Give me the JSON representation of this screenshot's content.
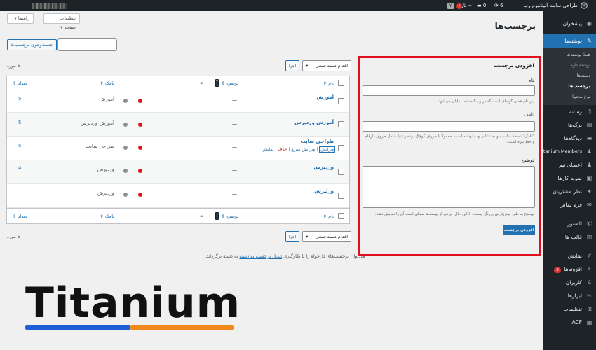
{
  "adminbar": {
    "site_name": "طراحی سایت آتیتانیوم وب",
    "updates": "6",
    "comments": "0",
    "new_label": "تازه",
    "notif_count": "!"
  },
  "top_buttons": {
    "screen_options": "تنظیمات صفحه",
    "help": "راهنما"
  },
  "page_title": "برچسب‌ها",
  "sidebar": {
    "items": [
      {
        "label": "پیشخوان",
        "icon": "dashboard-icon"
      },
      {
        "label": "نوشته‌ها",
        "icon": "pin-icon",
        "current": true
      },
      {
        "label": "رسانه",
        "icon": "media-icon"
      },
      {
        "label": "برگه‌ها",
        "icon": "page-icon"
      },
      {
        "label": "دیدگاه‌ها",
        "icon": "comment-icon"
      },
      {
        "label": "Titanium Members",
        "icon": "members-icon"
      },
      {
        "label": "اعضای تیم",
        "icon": "team-icon"
      },
      {
        "label": "نمونه کارها",
        "icon": "portfolio-icon"
      },
      {
        "label": "نظر مشتریان",
        "icon": "testimonial-icon"
      },
      {
        "label": "فرم تماس",
        "icon": "mail-icon"
      },
      {
        "label": "المنتور",
        "icon": "elementor-icon"
      },
      {
        "label": "قالب ها",
        "icon": "template-icon"
      },
      {
        "label": "نمایش",
        "icon": "brush-icon"
      },
      {
        "label": "افزونه‌ها",
        "icon": "plugin-icon",
        "badge": "5"
      },
      {
        "label": "کاربران",
        "icon": "users-icon"
      },
      {
        "label": "ابزارها",
        "icon": "tools-icon"
      },
      {
        "label": "تنظیمات",
        "icon": "settings-icon"
      },
      {
        "label": "ACF",
        "icon": "acf-icon"
      }
    ],
    "submenu": [
      "همهٔ نوشته‌ها",
      "نوشته تازه",
      "دسته‌ها",
      "برچسب‌ها",
      "نوع محتوا"
    ]
  },
  "search": {
    "button": "جست‌وجوی برچسب‌ها",
    "placeholder": ""
  },
  "add_tag": {
    "heading": "افزودن برچسب",
    "name_label": "نام",
    "name_desc": "این نام همان گونه‌ای است که در وب‌گاه شما نمایان می‌شود.",
    "slug_label": "نامک",
    "slug_desc": "“نامک” نسخهٔ مناسب و به نشانی وب نوشته است. معمولاً با حروف کوچک بوده و تنها شامل حروف، ارقام و خط تیره است.",
    "desc_label": "توضیح",
    "desc_desc": "توضیح به طور پیش‌فرض پررنگ نیست؛ با این حال، برخی از پوسته‌ها ممکن است آن را نمایش دهند.",
    "submit": "افزودن برچسب"
  },
  "bulk": {
    "select_label": "اقدام دسته‌جمعی",
    "apply": "اجرا",
    "items_count": "5 مورد"
  },
  "table": {
    "headers": {
      "name": "نام",
      "description": "توضیح",
      "slug": "نامک",
      "count": "تعداد"
    },
    "rows": [
      {
        "name": "آموزش",
        "description": "—",
        "slug": "آموزش",
        "count": "5"
      },
      {
        "name": "آموزش وردپرس",
        "description": "—",
        "slug": "آموزش-وردپرس",
        "count": "5"
      },
      {
        "name": "طراحی سایت",
        "description": "—",
        "slug": "طراحی-سایت",
        "count": "5",
        "actions": [
          "ویرایش",
          "ویرایش سریع",
          "حذف",
          "نمایش"
        ]
      },
      {
        "name": "وردپرس",
        "description": "—",
        "slug": "وردپرس",
        "count": "4"
      },
      {
        "name": "ورلپرش",
        "description": "—",
        "slug": "وردپرش",
        "count": "1"
      }
    ]
  },
  "footer_note": {
    "text_before": "می‌توان برچسب‌های دل‌خواه را با بکارگیری",
    "link": "تبدیل برچسب به دسته",
    "text_after": "به دسته برگرداند."
  },
  "logo": {
    "text": "Titanium"
  },
  "colors": {
    "accent": "#2271b1",
    "highlight_border": "#e0111c",
    "sidebar": "#1d2327",
    "logo_blue": "#1f5ed8",
    "logo_orange": "#f0891a"
  }
}
